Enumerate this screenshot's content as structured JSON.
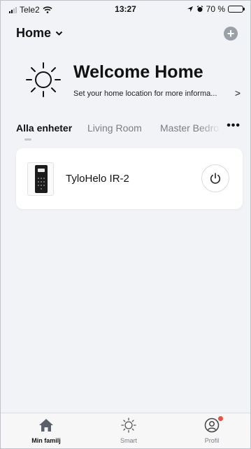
{
  "status_bar": {
    "carrier": "Tele2",
    "time": "13:27",
    "battery": "70 %",
    "battery_level": 0.7,
    "icons": [
      "signal-icon",
      "wifi-icon",
      "location-arrow-icon",
      "alarm-icon",
      "battery-icon"
    ]
  },
  "header": {
    "home_label": "Home",
    "dropdown_icon": "chevron-down-icon",
    "add_icon": "plus-circle-icon"
  },
  "welcome": {
    "title": "Welcome Home",
    "subtitle": "Set your home location for more informa...",
    "arrow": ">",
    "icon": "sun-icon"
  },
  "tabs": {
    "items": [
      {
        "label": "Alla enheter",
        "active": true
      },
      {
        "label": "Living Room",
        "active": false
      },
      {
        "label": "Master Bedro",
        "active": false
      }
    ],
    "more": "•••"
  },
  "devices": [
    {
      "name": "TyloHelo IR-2",
      "icon": "sauna-control-panel-icon",
      "power_icon": "power-icon"
    }
  ],
  "bottom_nav": [
    {
      "label": "Min familj",
      "icon": "home-icon",
      "active": true
    },
    {
      "label": "Smart",
      "icon": "sun-icon",
      "active": false
    },
    {
      "label": "Profil",
      "icon": "user-icon",
      "active": false,
      "badge": true
    }
  ],
  "colors": {
    "background": "#f2f3f6",
    "card": "#ffffff",
    "text": "#111111",
    "muted": "#7a7d83",
    "badge": "#f04e3e",
    "nav_active_icon": "#5c6068"
  }
}
